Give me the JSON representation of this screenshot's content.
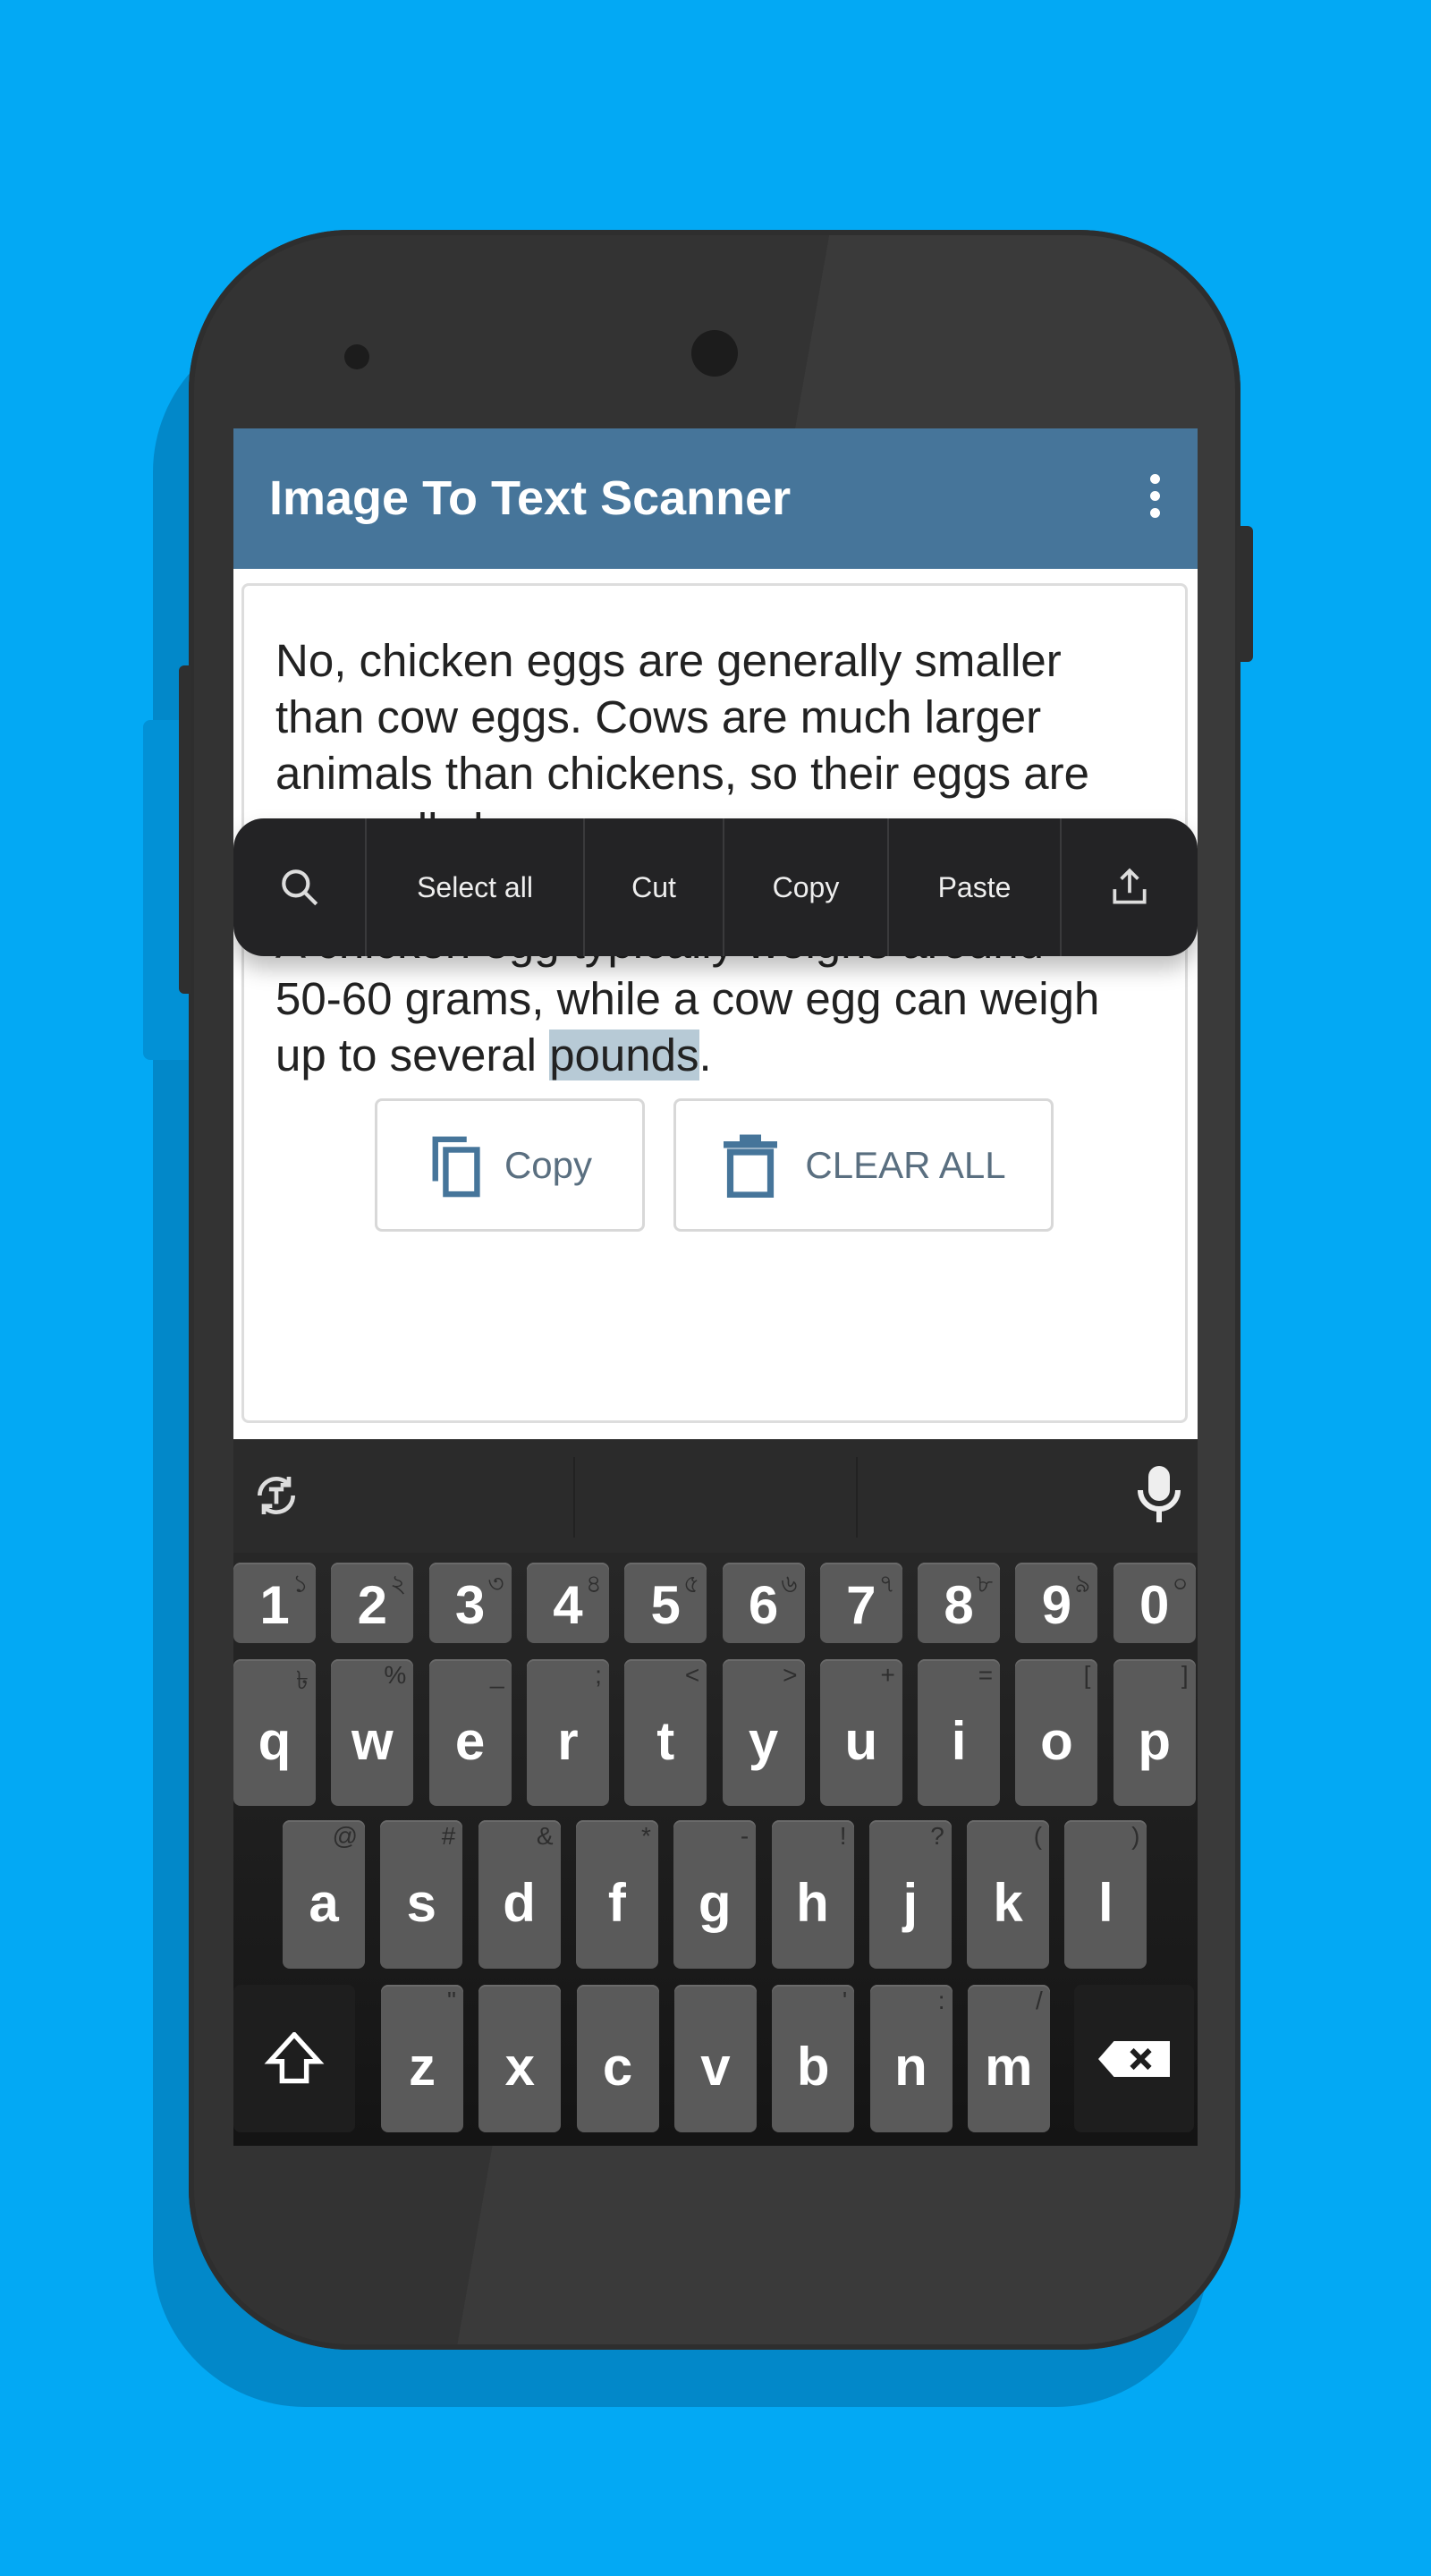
{
  "colors": {
    "background": "#03a9f4",
    "app_bar": "#46759a",
    "selection": "#b7cad6",
    "handle": "#0a90dc"
  },
  "app": {
    "title": "Image To Text Scanner",
    "menu_icon": "more-vert-icon"
  },
  "content": {
    "text_before": "No, chicken eggs are generally smaller\nthan cow eggs. Cows are much larger\nanimals than chickens, so their eggs are\ngenerally larger.\n\nA chicken egg typically weighs around\n50-60 grams, while a cow egg can weigh\nup to several ",
    "selected": "pounds",
    "text_after": "."
  },
  "context_menu": {
    "search_icon": "search-icon",
    "items": [
      "Select all",
      "Cut",
      "Copy",
      "Paste"
    ],
    "share_icon": "share-icon"
  },
  "actions": {
    "copy": "Copy",
    "clear_all": "CLEAR ALL"
  },
  "keyboard": {
    "suggestion_icons": [
      "translate-icon",
      "mic-icon"
    ],
    "rows": [
      [
        [
          "1",
          "১"
        ],
        [
          "2",
          "২"
        ],
        [
          "3",
          "৩"
        ],
        [
          "4",
          "৪"
        ],
        [
          "5",
          "৫"
        ],
        [
          "6",
          "৬"
        ],
        [
          "7",
          "৭"
        ],
        [
          "8",
          "৮"
        ],
        [
          "9",
          "৯"
        ],
        [
          "0",
          "০"
        ]
      ],
      [
        [
          "q",
          "৳"
        ],
        [
          "w",
          "%"
        ],
        [
          "e",
          "_"
        ],
        [
          "r",
          ";"
        ],
        [
          "t",
          "<"
        ],
        [
          "y",
          ">"
        ],
        [
          "u",
          "+"
        ],
        [
          "i",
          "="
        ],
        [
          "o",
          "["
        ],
        [
          "p",
          "]"
        ]
      ],
      [
        [
          "a",
          "@"
        ],
        [
          "s",
          "#"
        ],
        [
          "d",
          "&"
        ],
        [
          "f",
          "*"
        ],
        [
          "g",
          "-"
        ],
        [
          "h",
          "!"
        ],
        [
          "j",
          "?"
        ],
        [
          "k",
          "("
        ],
        [
          "l",
          ")"
        ]
      ],
      [
        [
          "z",
          "\""
        ],
        [
          "x",
          ""
        ],
        [
          "c",
          ""
        ],
        [
          "v",
          ""
        ],
        [
          "b",
          "'"
        ],
        [
          "n",
          ":"
        ],
        [
          "m",
          "/"
        ]
      ]
    ],
    "shift_icon": "shift-icon",
    "backspace_icon": "backspace-icon"
  }
}
